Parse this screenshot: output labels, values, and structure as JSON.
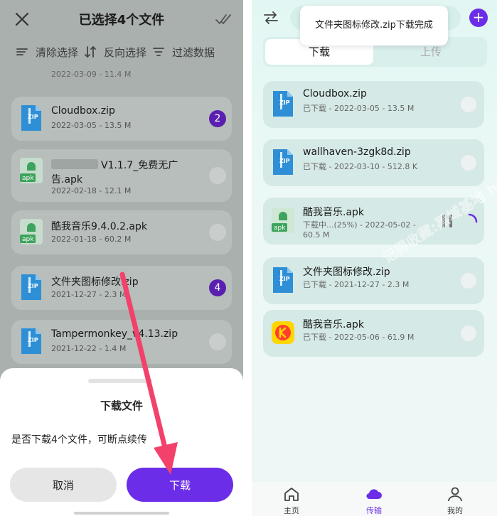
{
  "left": {
    "title": "已选择4个文件",
    "toolbar": {
      "clear": "清除选择",
      "invert": "反向选择",
      "filter": "过滤数据"
    },
    "ghost_meta": "2022-03-09 - 11.4 M",
    "rows": [
      {
        "name": "Cloudbox.zip",
        "meta": "2022-03-05 - 13.5 M",
        "badge": "2",
        "type": "zip"
      },
      {
        "name": "V1.1.7_免费无广",
        "name2": "告.apk",
        "meta": "2022-02-18 - 12.1 M",
        "badge": "",
        "type": "apk"
      },
      {
        "name": "酷我音乐9.4.0.2.apk",
        "meta": "2022-01-18 - 60.2 M",
        "badge": "",
        "type": "apk"
      },
      {
        "name": "文件夹图标修改.zip",
        "meta": "2021-12-27 - 2.3 M",
        "badge": "4",
        "type": "zip"
      },
      {
        "name": "Tampermonkey_v4.13.zip",
        "meta": "2021-12-22 - 1.4 M",
        "badge": "",
        "type": "zip"
      }
    ],
    "sheet": {
      "title": "下载文件",
      "message": "是否下载4个文件，可断点续传",
      "cancel": "取消",
      "download": "下载"
    },
    "zip_label": "ZIP",
    "apk_label": "apk"
  },
  "right": {
    "toast": "文件夹图标修改.zip下载完成",
    "plus": "+",
    "tabs": {
      "download": "下载",
      "upload": "上传"
    },
    "rows": [
      {
        "name": "Cloudbox.zip",
        "meta": "已下载 - 2022-03-05 - 13.5 M",
        "type": "zip"
      },
      {
        "name": "wallhaven-3zgk8d.zip",
        "meta": "已下载 - 2022-03-10 - 512.8 K",
        "type": "zip"
      },
      {
        "name": "酷我音乐.apk",
        "meta": "下载中...(25%) - 2022-05-02 - 60.5 M",
        "type": "apk"
      },
      {
        "name": "文件夹图标修改.zip",
        "meta": "已下载 - 2021-12-27 - 2.3 M",
        "type": "zip"
      },
      {
        "name": "酷我音乐.apk",
        "meta": "已下载 - 2022-05-06 - 61.9 M",
        "type": "kuwo"
      }
    ],
    "download_progress": 0.25,
    "nav": {
      "home": "主页",
      "transfer": "传输",
      "mine": "我的"
    },
    "watermark": "记得收藏:黑域基地 hybase.com",
    "zip_label": "ZIP",
    "apk_label": "apk"
  },
  "colors": {
    "accent": "#6b2de8",
    "badge": "#5a1fb0"
  }
}
